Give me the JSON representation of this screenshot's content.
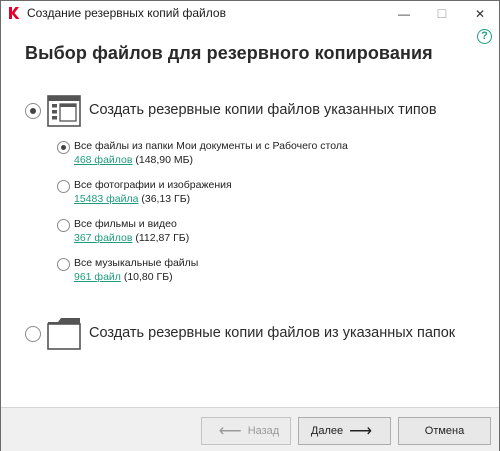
{
  "window": {
    "title": "Создание резервных копий файлов",
    "controls": {
      "minimize": "—",
      "maximize": "☐",
      "close": "✕"
    }
  },
  "help": {
    "glyph": "?"
  },
  "page": {
    "title": "Выбор файлов для резервного копирования"
  },
  "options": {
    "by_type": {
      "label": "Создать резервные копии файлов указанных типов",
      "selected": true,
      "icon": "file-types-icon"
    },
    "by_folder": {
      "label": "Создать резервные копии файлов из указанных папок",
      "selected": false,
      "icon": "folder-icon"
    }
  },
  "sub_options": [
    {
      "label": "Все файлы из папки Мои документы и с Рабочего стола",
      "count": "468 файлов",
      "size": "(148,90 МБ)",
      "selected": true
    },
    {
      "label": "Все фотографии и изображения",
      "count": "15483 файла",
      "size": "(36,13 ГБ)",
      "selected": false
    },
    {
      "label": "Все фильмы и видео",
      "count": "367 файлов",
      "size": "(112,87 ГБ)",
      "selected": false
    },
    {
      "label": "Все музыкальные файлы",
      "count": "961 файл",
      "size": "(10,80 ГБ)",
      "selected": false
    }
  ],
  "footer": {
    "back_label": "Назад",
    "next_label": "Далее",
    "cancel_label": "Отмена",
    "back_enabled": false
  },
  "colors": {
    "accent": "#1e9b7e",
    "brand": "#e4002b"
  }
}
